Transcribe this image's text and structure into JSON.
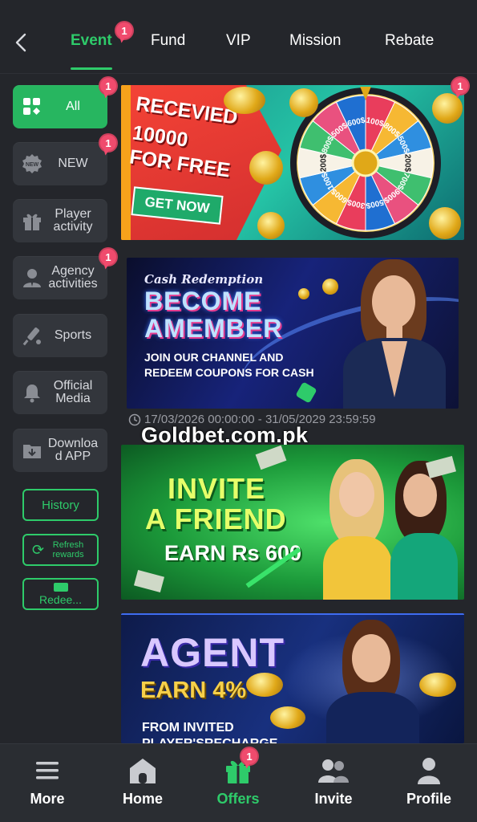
{
  "tabs": [
    {
      "label": "Event",
      "active": true,
      "badge": "1"
    },
    {
      "label": "Fund"
    },
    {
      "label": "VIP"
    },
    {
      "label": "Mission"
    },
    {
      "label": "Rebate"
    }
  ],
  "sidebar": {
    "items": [
      {
        "label": "All",
        "icon": "grid-icon",
        "badge": "1",
        "active": true
      },
      {
        "label": "NEW",
        "icon": "new-tag-icon",
        "badge": "1"
      },
      {
        "label": "Player activity",
        "icon": "gift-icon"
      },
      {
        "label": "Agency activities",
        "icon": "agent-icon",
        "badge": "1"
      },
      {
        "label": "Sports",
        "icon": "cricket-bat-icon"
      },
      {
        "label": "Official Media",
        "icon": "bell-icon"
      },
      {
        "label": "Downloa d APP",
        "icon": "download-icon"
      }
    ],
    "history_label": "History",
    "refresh_label": "Refresh rewards",
    "redeem_label": "Redee..."
  },
  "banners": {
    "wheel": {
      "badge": "1",
      "line1": "RECEVIED",
      "line2": "10000",
      "line3": "FOR FREE",
      "cta": "GET NOW",
      "wheel_labels": [
        "100$",
        "800$",
        "500$",
        "200$",
        "700$",
        "900$",
        "500$",
        "300$",
        "600$",
        "100$",
        "200$",
        "800$",
        "500$",
        "600$"
      ]
    },
    "member": {
      "kicker": "Cash Redemption",
      "line1": "BECOME",
      "line2": "AMEMBER",
      "sub1": "JOIN OUR CHANNEL AND",
      "sub2": "REDEEM COUPONS FOR CASH",
      "date_range": "17/03/2026 00:00:00 - 31/05/2029 23:59:59"
    },
    "invite": {
      "line1": "INVITE",
      "line2": "A FRIEND",
      "line3": "EARN Rs 600"
    },
    "agent": {
      "line1": "AGENT",
      "line2": "EARN 4%",
      "line3": "FROM INVITED",
      "line4": "PLAYER'SRECHARGE"
    }
  },
  "watermark": "Goldbet.com.pk",
  "bottom_nav": [
    {
      "label": "More",
      "icon": "menu-icon"
    },
    {
      "label": "Home",
      "icon": "home-icon"
    },
    {
      "label": "Offers",
      "icon": "gift-icon",
      "active": true,
      "badge": "1"
    },
    {
      "label": "Invite",
      "icon": "users-icon"
    },
    {
      "label": "Profile",
      "icon": "user-icon"
    }
  ],
  "colors": {
    "accent": "#2ecb6a",
    "background": "#24262b",
    "badge": "#f04b6d"
  }
}
